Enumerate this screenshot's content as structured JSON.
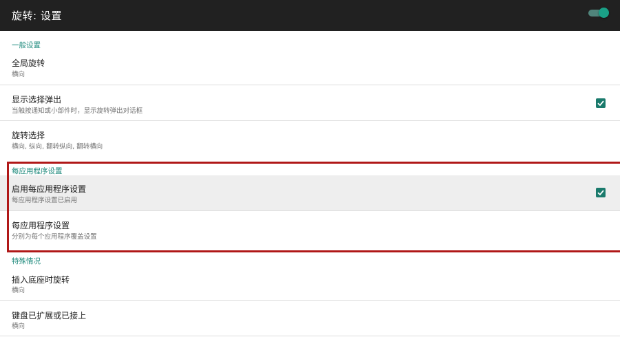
{
  "appbar": {
    "title": "旋转: 设置",
    "master_switch_on": true,
    "switch_color": "#1aa086"
  },
  "sections": {
    "general": {
      "header": "一般设置"
    },
    "per_app": {
      "header": "每应用程序设置"
    },
    "special": {
      "header": "特殊情况"
    }
  },
  "prefs": {
    "global_rotation": {
      "title": "全局旋转",
      "summary": "横向"
    },
    "show_popup": {
      "title": "显示选择弹出",
      "summary": "当触按通知或小部件时，显示旋转弹出对话框",
      "checked": true
    },
    "rotation_choice": {
      "title": "旋转选择",
      "summary": "横向, 纵向, 翻转纵向, 翻转横向"
    },
    "enable_per_app": {
      "title": "启用每应用程序设置",
      "summary": "每应用程序设置已启用",
      "checked": true
    },
    "per_app_settings": {
      "title": "每应用程序设置",
      "summary": "分别为每个应用程序覆盖设置"
    },
    "dock_rotation": {
      "title": "插入底座时旋转",
      "summary": "横向"
    },
    "keyboard": {
      "title": "键盘已扩展或已接上",
      "summary": "横向"
    }
  },
  "colors": {
    "accent": "#1e8a7c",
    "checkbox": "#1a7a6c",
    "highlight_border": "#b01818",
    "appbar": "#212121"
  }
}
